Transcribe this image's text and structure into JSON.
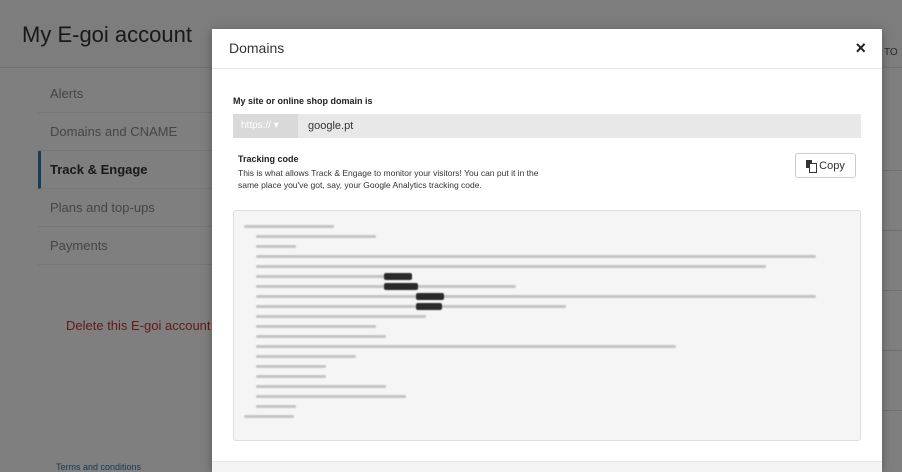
{
  "page": {
    "title": "My E-goi account",
    "sidebar": {
      "items": [
        {
          "label": "Alerts"
        },
        {
          "label": "Domains and CNAME"
        },
        {
          "label": "Track & Engage"
        },
        {
          "label": "Plans and top-ups"
        },
        {
          "label": "Payments"
        }
      ],
      "active_index": 2,
      "delete_label": "Delete this E-goi account",
      "terms_label": "Terms and conditions"
    },
    "right_partial_label": "TO"
  },
  "modal": {
    "title": "Domains",
    "close_symbol": "×",
    "domain_label": "My site or online shop domain is",
    "protocol_value": "https:// ▾",
    "domain_value": "google.pt",
    "tracking_title": "Tracking code",
    "tracking_description": "This is what allows Track & Engage to monitor your visitors! You can put it in the same place you've got, say, your Google Analytics tracking code.",
    "copy_label": "Copy"
  },
  "colors": {
    "accent": "#2b79b3",
    "danger": "#c0392b"
  },
  "icons": {
    "close": "close-icon",
    "copy": "copy-icon"
  }
}
